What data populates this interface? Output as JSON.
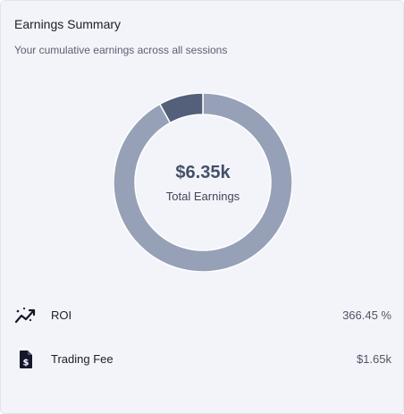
{
  "card": {
    "title": "Earnings Summary",
    "subtitle": "Your cumulative earnings across all sessions"
  },
  "donut": {
    "center_value": "$6.35k",
    "center_label": "Total Earnings",
    "segments": [
      {
        "share": 0.92,
        "color": "#96a1b8"
      },
      {
        "share": 0.08,
        "color": "#545f7a"
      }
    ]
  },
  "stats": [
    {
      "label": "ROI",
      "value": "366.45 %",
      "icon": "trending-up-icon"
    },
    {
      "label": "Trading Fee",
      "value": "$1.65k",
      "icon": "dollar-document-icon"
    }
  ]
}
